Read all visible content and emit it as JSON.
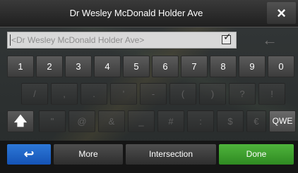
{
  "title": "Dr Wesley McDonald Holder Ave",
  "close_icon": "×",
  "input": {
    "value": "<Dr Wesley McDonald Holder Ave>",
    "checkbox": "✓"
  },
  "backspace_icon": "←",
  "keyboard": {
    "row1": [
      "1",
      "2",
      "3",
      "4",
      "5",
      "6",
      "7",
      "8",
      "9",
      "0"
    ],
    "row2": [
      "/",
      ",",
      ".",
      "'",
      "-",
      "(",
      ")",
      "?",
      "!"
    ],
    "row3": [
      "\"",
      "@",
      "&",
      "_",
      "#",
      ":",
      "$",
      "€"
    ],
    "shift_icon": "🡅",
    "layout_switch": "QWE"
  },
  "bottom": {
    "back_icon": "↩",
    "more": "More",
    "intersection": "Intersection",
    "done": "Done"
  }
}
